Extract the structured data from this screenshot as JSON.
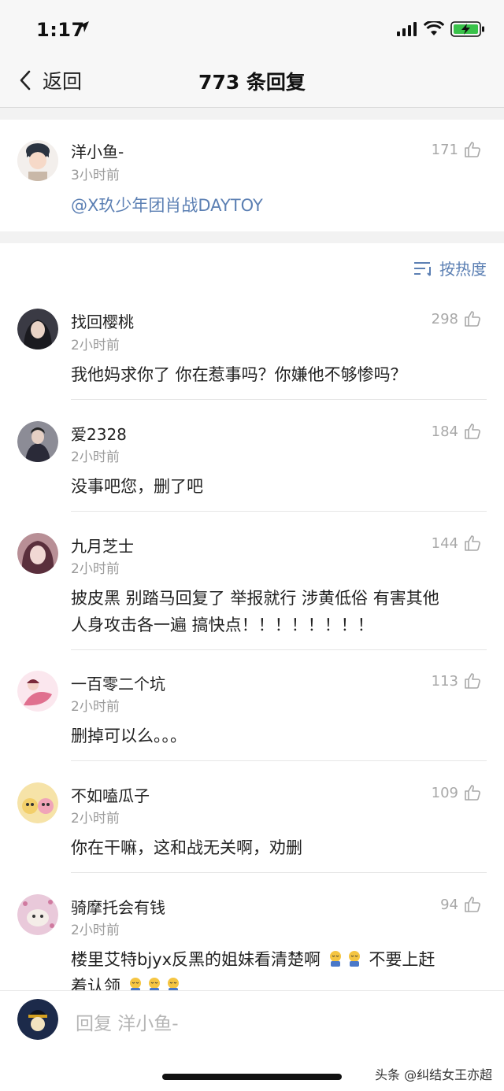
{
  "status_bar": {
    "time": "1:17"
  },
  "nav": {
    "back_label": "返回",
    "title": "773 条回复"
  },
  "original_comment": {
    "username": "洋小鱼-",
    "time": "3小时前",
    "likes": "171",
    "mention": "@X玖少年团肖战DAYTOY",
    "avatar_color": "#2b3340"
  },
  "sort": {
    "label": "按热度"
  },
  "replies": [
    {
      "username": "找回樱桃",
      "time": "2小时前",
      "likes": "298",
      "content": "我他妈求你了 你在惹事吗？你嫌他不够惨吗？",
      "avatar_color": "#3a3a44"
    },
    {
      "username": "爱2328",
      "time": "2小时前",
      "likes": "184",
      "content": "没事吧您，删了吧",
      "avatar_color": "#4a4a5a"
    },
    {
      "username": "九月芝士",
      "time": "2小时前",
      "likes": "144",
      "content_line1": "披皮黑 别踏马回复了 举报就行 涉黄低俗 有害其他",
      "content_line2": "人身攻击各一遍 搞快点！！！！！！！！",
      "avatar_color": "#7a4a55"
    },
    {
      "username": "一百零二个坑",
      "time": "2小时前",
      "likes": "113",
      "content": "删掉可以么。。。",
      "avatar_color": "#e68aa8"
    },
    {
      "username": "不如嗑瓜子",
      "time": "2小时前",
      "likes": "109",
      "content": "你在干嘛，这和战无关啊，劝删",
      "avatar_color": "#e0b060"
    },
    {
      "username": "骑摩托会有钱",
      "time": "2小时前",
      "likes": "94",
      "content_line1a": "楼里艾特bjyx反黑的姐妹看清楚啊",
      "content_line1b": "不要上赶",
      "content_line2": "着认领",
      "avatar_color": "#c8a0b8"
    }
  ],
  "reply_bar": {
    "placeholder": "回复 洋小鱼-",
    "avatar_color": "#1c2a4a"
  },
  "watermark": "头条 @纠结女王亦超",
  "colors": {
    "link": "#5b7fb3",
    "secondary_text": "#9a9a9a",
    "background_gray": "#f2f2f2"
  }
}
